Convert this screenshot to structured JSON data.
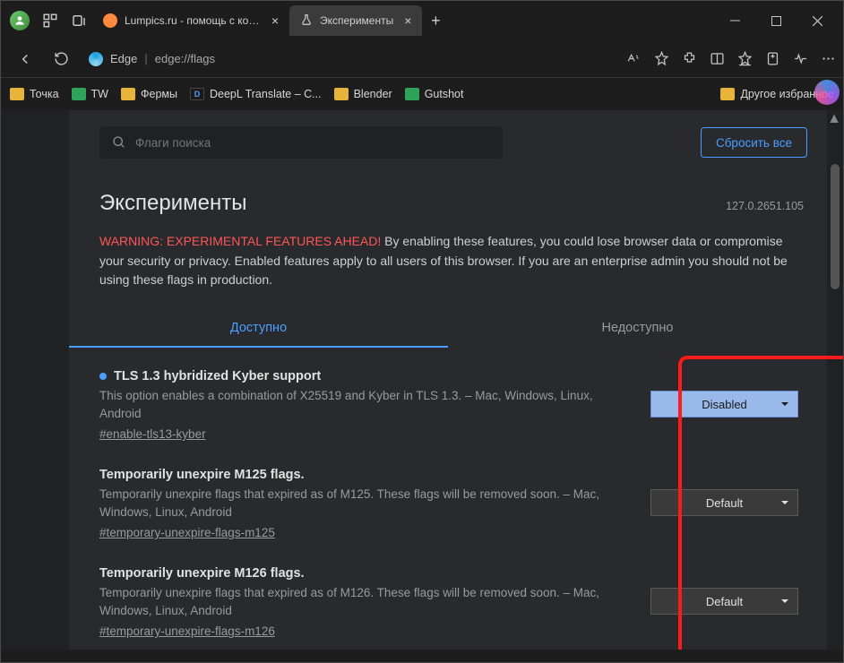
{
  "titlebar": {
    "tabs": [
      {
        "label": "Lumpics.ru - помощь с компью",
        "type": "site"
      },
      {
        "label": "Эксперименты",
        "type": "flask"
      }
    ]
  },
  "toolbar": {
    "browser": "Edge",
    "url": "edge://flags"
  },
  "bookmarks": {
    "items": [
      {
        "label": "Точка",
        "icon": "folder"
      },
      {
        "label": "TW",
        "icon": "green"
      },
      {
        "label": "Фермы",
        "icon": "folder"
      },
      {
        "label": "DeepL Translate – C...",
        "icon": "dark"
      },
      {
        "label": "Blender",
        "icon": "folder"
      },
      {
        "label": "Gutshot",
        "icon": "green"
      }
    ],
    "other": "Другое избранное"
  },
  "page": {
    "search_placeholder": "Флаги поиска",
    "reset": "Сбросить все",
    "title": "Эксперименты",
    "version": "127.0.2651.105",
    "warning_red": "WARNING: EXPERIMENTAL FEATURES AHEAD!",
    "warning_rest": " By enabling these features, you could lose browser data or compromise your security or privacy. Enabled features apply to all users of this browser. If you are an enterprise admin you should not be using these flags in production.",
    "tab_available": "Доступно",
    "tab_unavailable": "Недоступно"
  },
  "flags": [
    {
      "title": "TLS 1.3 hybridized Kyber support",
      "desc": "This option enables a combination of X25519 and Kyber in TLS 1.3. – Mac, Windows, Linux, Android",
      "anchor": "#enable-tls13-kyber",
      "value": "Disabled",
      "modified": true
    },
    {
      "title": "Temporarily unexpire M125 flags.",
      "desc": "Temporarily unexpire flags that expired as of M125. These flags will be removed soon. – Mac, Windows, Linux, Android",
      "anchor": "#temporary-unexpire-flags-m125",
      "value": "Default",
      "modified": false
    },
    {
      "title": "Temporarily unexpire M126 flags.",
      "desc": "Temporarily unexpire flags that expired as of M126. These flags will be removed soon. – Mac, Windows, Linux, Android",
      "anchor": "#temporary-unexpire-flags-m126",
      "value": "Default",
      "modified": false
    }
  ]
}
